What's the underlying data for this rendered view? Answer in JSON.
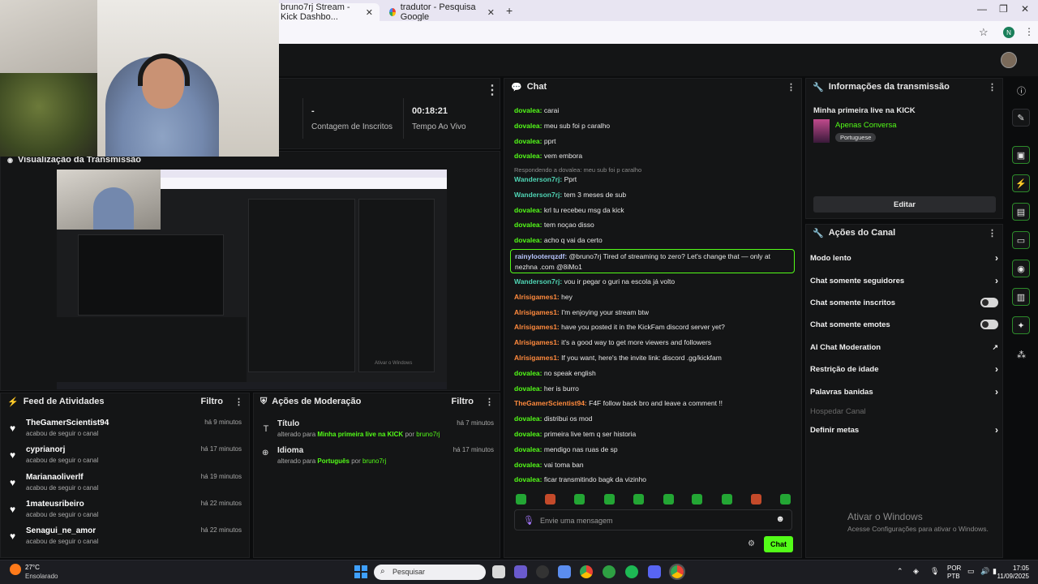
{
  "browser": {
    "tabs": [
      {
        "label": "bruno7rj Stream - Kick Dashbo..."
      },
      {
        "label": "tradutor - Pesquisa Google"
      }
    ],
    "new_tab": "+",
    "profile": "N"
  },
  "stats": {
    "subs_value": "-",
    "subs_label": "Contagem de Inscritos",
    "live_value": "00:18:21",
    "live_label": "Tempo Ao Vivo"
  },
  "preview": {
    "title": "Visualização da Transmissão"
  },
  "feed": {
    "title": "Feed de Atividades",
    "filter": "Filtro",
    "items": [
      {
        "name": "TheGamerScientist94",
        "text": "acabou de seguir o canal",
        "time": "há 9 minutos"
      },
      {
        "name": "cyprianorj",
        "text": "acabou de seguir o canal",
        "time": "há 17 minutos"
      },
      {
        "name": "Marianaoliverlf",
        "text": "acabou de seguir o canal",
        "time": "há 19 minutos"
      },
      {
        "name": "1mateusribeiro",
        "text": "acabou de seguir o canal",
        "time": "há 22 minutos"
      },
      {
        "name": "Senagui_ne_amor",
        "text": "acabou de seguir o canal",
        "time": "há 22 minutos"
      }
    ]
  },
  "moderation": {
    "title": "Ações de Moderação",
    "filter": "Filtro",
    "items": [
      {
        "label": "Título",
        "pre": "alterado para",
        "value": "Minha primeira live na KICK",
        "by": "por",
        "user": "bruno7rj",
        "time": "há 7 minutos"
      },
      {
        "label": "Idioma",
        "pre": "alterado para",
        "value": "Português",
        "by": "por",
        "user": "bruno7rj",
        "time": "há 17 minutos"
      }
    ]
  },
  "chat": {
    "title": "Chat",
    "messages": [
      {
        "user": "dovalea:",
        "text": "carai",
        "color": "g"
      },
      {
        "user": "dovalea:",
        "text": "meu sub foi p caralho",
        "color": "g"
      },
      {
        "user": "dovalea:",
        "text": "pprt",
        "color": "g"
      },
      {
        "user": "dovalea:",
        "text": "vem embora",
        "color": "g"
      },
      {
        "user": "",
        "text": "Respondendo a dovalea: meu sub foi p caralho",
        "color": "reply"
      },
      {
        "user": "Wanderson7rj:",
        "text": "Pprt",
        "color": "t"
      },
      {
        "user": "Wanderson7rj:",
        "text": "tem 3 meses de sub",
        "color": "t"
      },
      {
        "user": "dovalea:",
        "text": "krl tu recebeu msg da kick",
        "color": "g"
      },
      {
        "user": "dovalea:",
        "text": "tem noçao disso",
        "color": "g"
      },
      {
        "user": "dovalea:",
        "text": "acho q vai da certo",
        "color": "g"
      }
    ],
    "highlight": {
      "user": "rainylooterqzdf:",
      "line1": "@bruno7rj Tired of streaming to zero? Let's change that — only at",
      "line2": "nezhna .com @8iMo1"
    },
    "messages2": [
      {
        "user": "Wanderson7rj:",
        "text": "vou ir pegar o guri na escola já volto",
        "color": "t"
      },
      {
        "user": "Alrisigames1:",
        "text": "hey",
        "color": "o"
      },
      {
        "user": "Alrisigames1:",
        "text": "I'm enjoying your stream btw",
        "color": "o"
      },
      {
        "user": "Alrisigames1:",
        "text": "have you posted it in the KickFam discord server yet?",
        "color": "o"
      },
      {
        "user": "Alrisigames1:",
        "text": "it's a good way to get more viewers and followers",
        "color": "o"
      },
      {
        "user": "Alrisigames1:",
        "text": "If you want, here's the invite link: discord .gg/kickfam",
        "color": "o"
      },
      {
        "user": "dovalea:",
        "text": "no speak english",
        "color": "g"
      },
      {
        "user": "dovalea:",
        "text": "her is burro",
        "color": "g"
      },
      {
        "user": "TheGamerScientist94:",
        "text": "F4F follow back bro and leave a comment !!",
        "color": "o"
      },
      {
        "user": "dovalea:",
        "text": "distribui os mod",
        "color": "g"
      },
      {
        "user": "dovalea:",
        "text": "primeira live tem q ser historia",
        "color": "g"
      },
      {
        "user": "dovalea:",
        "text": "mendigo nas ruas de sp",
        "color": "g"
      },
      {
        "user": "dovalea:",
        "text": "vai toma ban",
        "color": "g"
      },
      {
        "user": "dovalea:",
        "text": "ficar transmitindo bagk da vizinho",
        "color": "g"
      }
    ],
    "placeholder": "Envie uma mensagem",
    "send": "Chat"
  },
  "info": {
    "title": "Informações da transmissão",
    "stream_title": "Minha primeira live na KICK",
    "category": "Apenas Conversa",
    "language": "Portuguese",
    "edit": "Editar"
  },
  "actions": {
    "title": "Ações do Canal",
    "items": [
      {
        "label": "Modo lento",
        "control": "chevron"
      },
      {
        "label": "Chat somente seguidores",
        "control": "chevron"
      },
      {
        "label": "Chat somente inscritos",
        "control": "toggle"
      },
      {
        "label": "Chat somente emotes",
        "control": "toggle"
      },
      {
        "label": "AI Chat Moderation",
        "control": "external"
      },
      {
        "label": "Restrição de idade",
        "control": "chevron"
      },
      {
        "label": "Palavras banidas",
        "control": "chevron"
      },
      {
        "label": "Hospedar Canal",
        "control": "none"
      },
      {
        "label": "Definir metas",
        "control": "chevron"
      }
    ]
  },
  "watermark": {
    "line1": "Ativar o Windows",
    "line2": "Acesse Configurações para ativar o Windows."
  },
  "taskbar": {
    "temp": "27°C",
    "weather": "Ensolarado",
    "search": "Pesquisar",
    "lang1": "POR",
    "lang2": "PTB",
    "time": "17:05",
    "date": "11/09/2025"
  },
  "colors": {
    "accent": "#53fc18",
    "bg": "#0b0c0d",
    "panel": "#141516"
  }
}
